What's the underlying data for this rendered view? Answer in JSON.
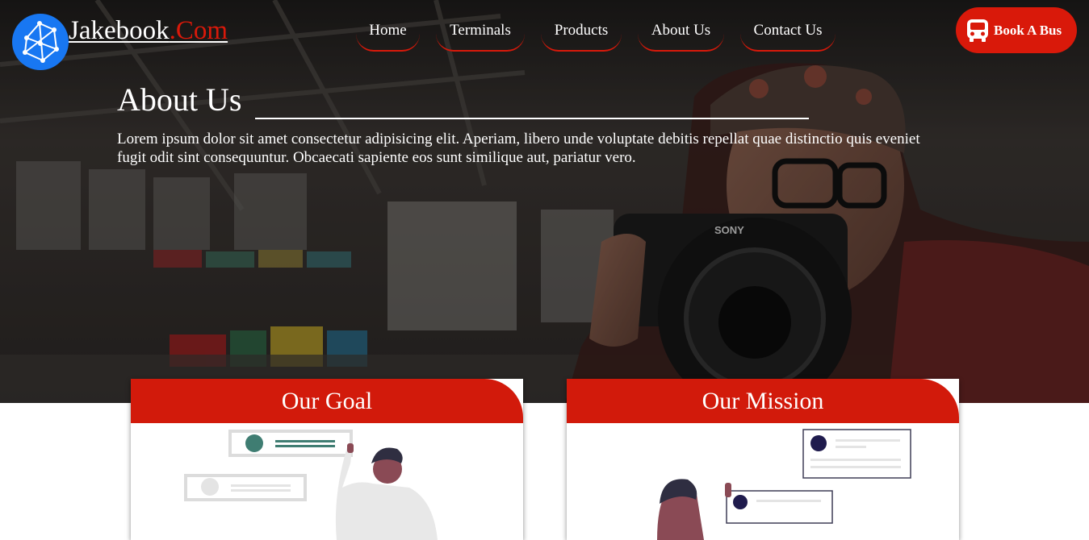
{
  "brand": {
    "name": "Jakebook",
    "suffix": ".Com"
  },
  "nav": [
    {
      "label": "Home"
    },
    {
      "label": "Terminals"
    },
    {
      "label": "Products"
    },
    {
      "label": "About Us"
    },
    {
      "label": "Contact Us"
    }
  ],
  "book_button": {
    "label": "Book A Bus",
    "icon": "bus-icon"
  },
  "about": {
    "title": "About Us",
    "text": "Lorem ipsum dolor sit amet consectetur adipisicing elit. Aperiam, libero unde voluptate debitis repellat quae distinctio quis eveniet fugit odit sint consequuntur. Obcaecati sapiente eos sunt similique aut, pariatur vero."
  },
  "cards": [
    {
      "title": "Our Goal"
    },
    {
      "title": "Our Mission"
    }
  ],
  "colors": {
    "accent": "#d9190a",
    "logo_blue": "#1877f2",
    "text": "#ffffff"
  }
}
